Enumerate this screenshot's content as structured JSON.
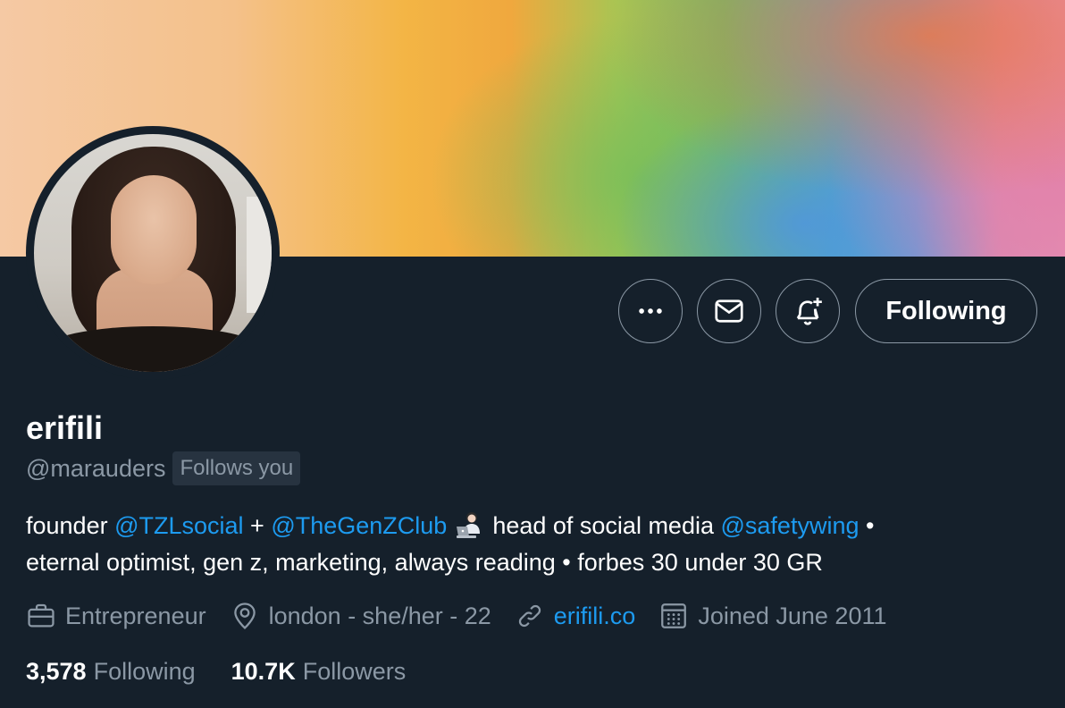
{
  "profile": {
    "display_name": "erifili",
    "handle": "@marauders",
    "follows_you": "Follows you"
  },
  "actions": {
    "more_icon": "more-horizontal-icon",
    "message_icon": "envelope-icon",
    "notify_icon": "bell-plus-icon",
    "following_label": "Following"
  },
  "bio": {
    "t1": "founder ",
    "m1": "@TZLsocial",
    "t2": " + ",
    "m2": "@TheGenZClub",
    "emoji": "person-with-laptop-emoji",
    "t3": " head of social media ",
    "m3": "@safetywing",
    "t4": " •",
    "line2": "eternal optimist, gen z, marketing, always reading • forbes 30 under 30 GR"
  },
  "meta": {
    "profession": "Entrepreneur",
    "location": "london - she/her - 22",
    "website": "erifili.co",
    "joined": "Joined June 2011"
  },
  "stats": {
    "following_count": "3,578",
    "following_label": "Following",
    "followers_count": "10.7K",
    "followers_label": "Followers"
  },
  "colors": {
    "background": "#15202b",
    "link": "#1d9bf0",
    "muted": "#8b98a5"
  }
}
